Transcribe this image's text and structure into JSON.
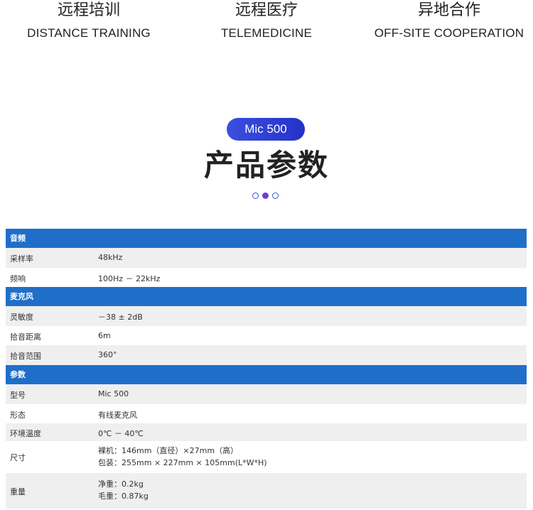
{
  "features": [
    {
      "cn": "远程培训",
      "en": "DISTANCE TRAINING"
    },
    {
      "cn": "远程医疗",
      "en": "TELEMEDICINE"
    },
    {
      "cn": "异地合作",
      "en": "OFF-SITE COOPERATION"
    }
  ],
  "product": {
    "badge": "Mic 500",
    "title": "产品参数"
  },
  "colors": {
    "accent": "#2f43d8",
    "header_bar": "#1f6fc8",
    "active_dot": "#6a3ed6",
    "row_alt": "#efefef"
  },
  "specs": {
    "audio": {
      "header": "音频",
      "rows": [
        {
          "label": "采样率",
          "value": "48kHz"
        },
        {
          "label": "频响",
          "value": "100Hz － 22kHz"
        }
      ]
    },
    "microphone": {
      "header": "麦克风",
      "rows": [
        {
          "label": "灵敏度",
          "value": "－38 ± 2dB"
        },
        {
          "label": "拾音距离",
          "value": "6m"
        },
        {
          "label": "拾音范围",
          "value": "360°"
        }
      ]
    },
    "params": {
      "header": "参数",
      "rows": [
        {
          "label": "型号",
          "value": "Mic 500"
        },
        {
          "label": "形态",
          "value": "有线麦克风"
        },
        {
          "label": "环境温度",
          "value": "0℃ － 40℃"
        },
        {
          "label": "尺寸",
          "value_lines": [
            "裸机：146mm（直径）×27mm（高）",
            "包装：255mm × 227mm × 105mm(L*W*H)"
          ]
        },
        {
          "label": "重量",
          "value_lines": [
            "净重：0.2kg",
            "毛重：0.87kg"
          ]
        }
      ]
    }
  }
}
